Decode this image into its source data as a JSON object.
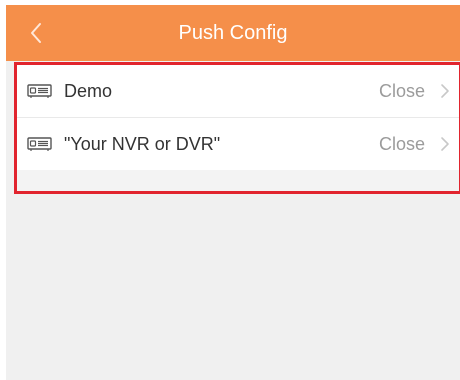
{
  "header": {
    "title": "Push Config",
    "background": "#f58f4a"
  },
  "list": {
    "items": [
      {
        "name": "Demo",
        "status": "Close"
      },
      {
        "name": "\"Your NVR or DVR\"",
        "status": "Close"
      }
    ]
  },
  "icons": {
    "back": "chevron-left-icon",
    "device": "dvr-device-icon",
    "row_arrow": "chevron-right-icon"
  },
  "highlight_color": "#e1242e"
}
